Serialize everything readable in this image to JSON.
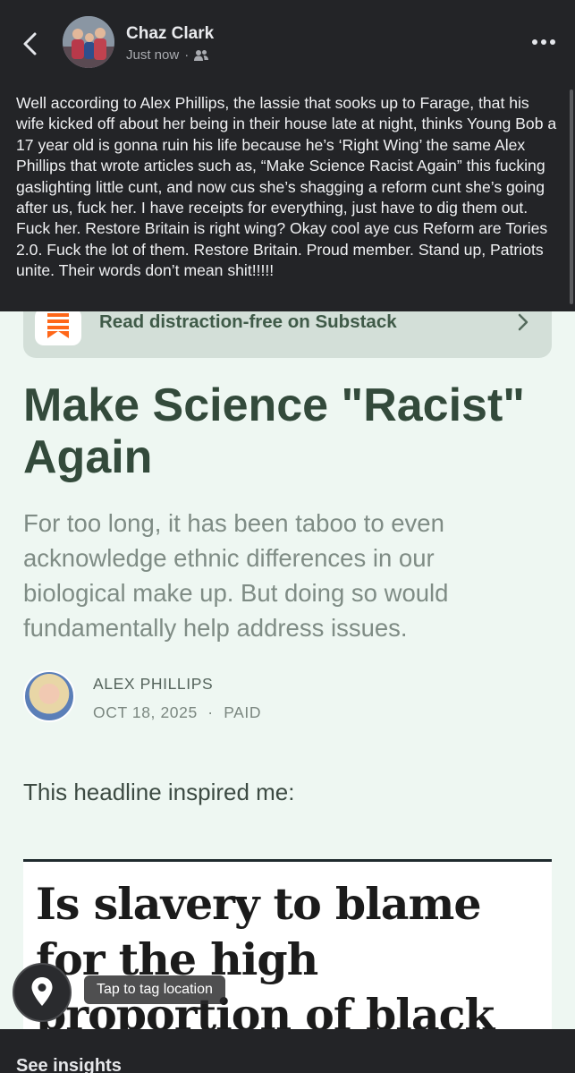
{
  "post": {
    "author": "Chaz Clark",
    "time": "Just now",
    "meta_separator": "·",
    "audience_icon": "friends-icon",
    "text": "Well according to Alex Phillips, the lassie that sooks up to Farage, that his wife kicked off about her being in their house late at night, thinks Young Bob a 17 year old is gonna ruin his life because he’s ‘Right Wing’ the same Alex Phillips that wrote articles such as, “Make Science Racist Again” this fucking gaslighting little cunt, and now cus she’s shagging a reform cunt she’s going after us, fuck her. I have receipts for everything, just have to dig them out. Fuck her. Restore Britain is right wing? Okay cool aye cus Reform are Tories 2.0. Fuck the lot of them. Restore Britain. Proud member. Stand up, Patriots unite. Their words don’t mean shit!!!!!"
  },
  "substack": {
    "banner_label": "Read distraction-free on Substack",
    "logo_color": "#ff6719"
  },
  "article": {
    "title": "Make Science \"Racist\" Again",
    "subtitle": "For too long, it has been taboo to even acknowledge ethnic differences in our biological make up. But doing so would fundamentally help address issues.",
    "author": "ALEX PHILLIPS",
    "date": "OCT 18, 2025",
    "date_separator": "·",
    "access": "PAID",
    "body_intro": "This headline inspired me:",
    "embedded_headline": "Is slavery to blame for the high proportion of black people in"
  },
  "overlay": {
    "tag_location": "Tap to tag location",
    "see_insights": "See insights"
  },
  "colors": {
    "header_bg": "#232427",
    "page_bg": "#eef7f2",
    "title_green": "#334a3b"
  }
}
